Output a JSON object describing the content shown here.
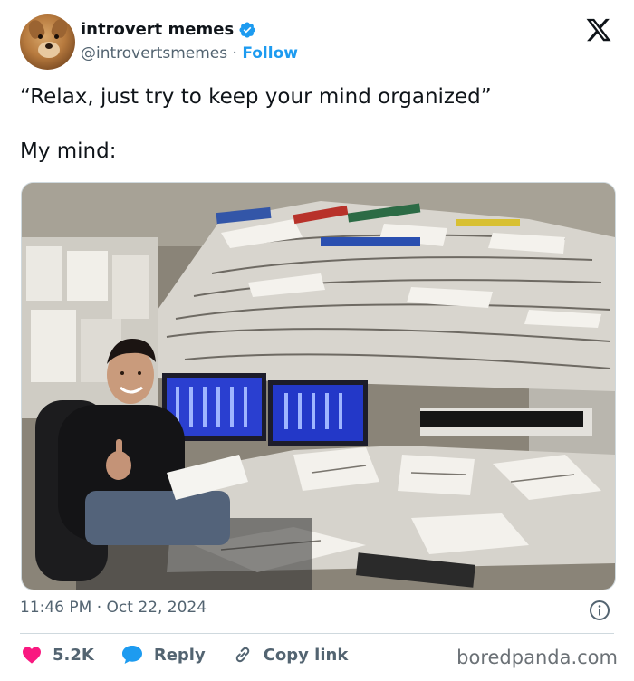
{
  "author": {
    "display_name": "introvert memes",
    "handle": "@introvertsmemes",
    "separator": "·",
    "follow_label": "Follow",
    "verified": true,
    "verified_color": "#1d9bf0"
  },
  "tweet": {
    "text": "“Relax, just try to keep your mind organized”\n\nMy mind:",
    "time": "11:46 PM",
    "date": "Oct 22, 2024",
    "meta_separator": "·"
  },
  "media": {
    "icon": "photo-of-man-in-cluttered-office"
  },
  "actions": {
    "like_count": "5.2K",
    "like_color": "#f91880",
    "reply_label": "Reply",
    "reply_color": "#1d9bf0",
    "copy_label": "Copy link"
  },
  "watermark": "boredpanda.com",
  "icons": {
    "platform": "x-logo-icon",
    "info": "info-icon",
    "like": "heart-icon",
    "reply": "speech-bubble-icon",
    "copy": "link-icon"
  }
}
